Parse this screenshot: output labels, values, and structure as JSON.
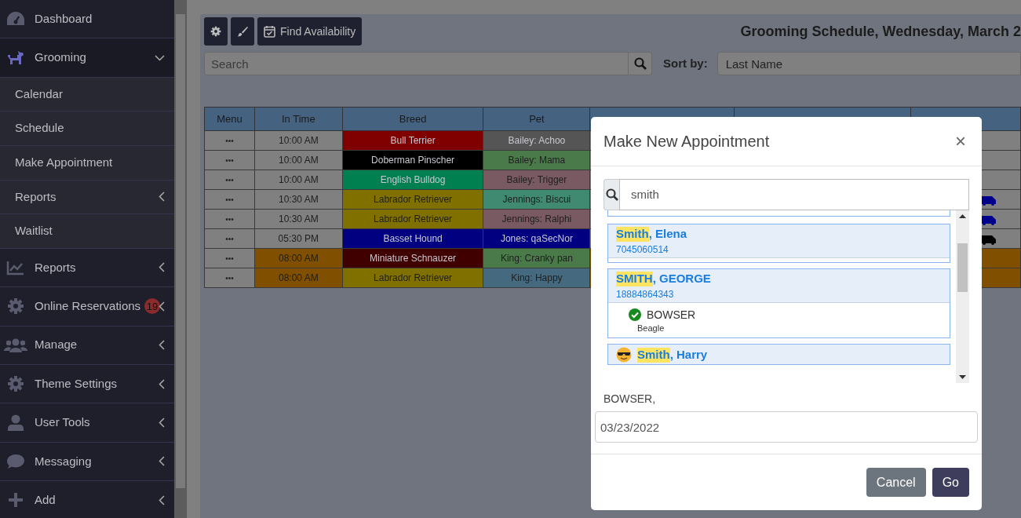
{
  "sidebar": {
    "items": [
      {
        "label": "Dashboard",
        "kind": "gauge",
        "has_submenu": false
      },
      {
        "label": "Grooming",
        "kind": "dog",
        "has_submenu": true,
        "expanded": true,
        "children": [
          {
            "label": "Calendar",
            "has_submenu": false
          },
          {
            "label": "Schedule",
            "has_submenu": false
          },
          {
            "label": "Make Appointment",
            "has_submenu": false
          },
          {
            "label": "Reports",
            "has_submenu": true
          },
          {
            "label": "Waitlist",
            "has_submenu": false
          }
        ]
      },
      {
        "label": "Reports",
        "kind": "chart",
        "has_submenu": true,
        "expanded": false
      },
      {
        "label": "Online Reservations",
        "kind": "gear",
        "has_submenu": true,
        "expanded": false,
        "badge": "19"
      },
      {
        "label": "Manage",
        "kind": "users",
        "has_submenu": true,
        "expanded": false
      },
      {
        "label": "Theme Settings",
        "kind": "gear",
        "has_submenu": true,
        "expanded": false
      },
      {
        "label": "User Tools",
        "kind": "person",
        "has_submenu": true,
        "expanded": false
      },
      {
        "label": "Messaging",
        "kind": "sms",
        "has_submenu": true,
        "expanded": false
      },
      {
        "label": "Add",
        "kind": "plus",
        "has_submenu": true,
        "expanded": false
      }
    ]
  },
  "toolbar": {
    "buttons": [
      {
        "kind": "gear"
      },
      {
        "kind": "brush"
      },
      {
        "kind": "calendar",
        "label": "Find Availability"
      }
    ],
    "title": "Grooming Schedule, Wednesday, March 2"
  },
  "search": {
    "placeholder": "Search",
    "sort_label": "Sort by:",
    "sort_value": "Last Name"
  },
  "table": {
    "columns": [
      "Menu",
      "In Time",
      "Breed",
      "Pet"
    ],
    "rows": [
      {
        "menu": "•••",
        "in_time": {
          "text": "10:00 AM",
          "color": "#808080"
        },
        "breed": {
          "text": "Bull Terrier",
          "color": "#800000"
        },
        "pet": {
          "text": "Bailey: Achoo",
          "color": "#555555"
        },
        "rest": {
          "color": "#808080"
        }
      },
      {
        "menu": "•••",
        "in_time": {
          "text": "10:00 AM",
          "color": "#808080"
        },
        "breed": {
          "text": "Doberman Pinscher",
          "color": "#000000"
        },
        "pet": {
          "text": "Bailey: Mama",
          "color": "#4a7a4a"
        },
        "rest": {
          "color": "#808080"
        }
      },
      {
        "menu": "•••",
        "in_time": {
          "text": "10:00 AM",
          "color": "#808080"
        },
        "breed": {
          "text": "English Bulldog",
          "color": "#008050"
        },
        "pet": {
          "text": "Bailey: Trigger",
          "color": "#7a5a62"
        },
        "rest": {
          "color": "#808080"
        }
      },
      {
        "menu": "•••",
        "in_time": {
          "text": "10:30 AM",
          "color": "#808080"
        },
        "breed": {
          "text": "Labrador Retriever",
          "color": "#807000"
        },
        "pet": {
          "text": "Jennings: Biscui",
          "color": "#3f8a70"
        },
        "rest": {
          "color": "#808080"
        },
        "van": {
          "color": "#00008b"
        }
      },
      {
        "menu": "•••",
        "in_time": {
          "text": "10:30 AM",
          "color": "#808080"
        },
        "breed": {
          "text": "Labrador Retriever",
          "color": "#807000"
        },
        "pet": {
          "text": "Jennings: Ralphi",
          "color": "#7a5a62"
        },
        "rest": {
          "color": "#808080"
        },
        "van": {
          "color": "#00008b"
        }
      },
      {
        "menu": "•••",
        "in_time": {
          "text": "05:30 PM",
          "color": "#808080"
        },
        "breed": {
          "text": "Basset Hound",
          "color": "#000080"
        },
        "pet": {
          "text": "Jones: qaSecNor",
          "color": "#000080"
        },
        "rest": {
          "color": "#808080"
        },
        "van": {
          "color": "#000000"
        }
      },
      {
        "menu": "•••",
        "in_time": {
          "text": "08:00 AM",
          "color": "#805000"
        },
        "breed": {
          "text": "Miniature Schnauzer",
          "color": "#400000"
        },
        "pet": {
          "text": "King: Cranky pan",
          "color": "#4a7a4a"
        },
        "rest": {
          "color": "#805000"
        }
      },
      {
        "menu": "•••",
        "in_time": {
          "text": "08:00 AM",
          "color": "#805000"
        },
        "breed": {
          "text": "Labrador Retriever",
          "color": "#807000"
        },
        "pet": {
          "text": "King: Happy",
          "color": "#456a80"
        },
        "rest": {
          "color": "#805000"
        }
      }
    ]
  },
  "modal": {
    "title": "Make New Appointment",
    "close": "×",
    "search_value": "smith",
    "customers": [
      {
        "name_match": "Smith",
        "name_rest": ", Elena",
        "phone": "7045060514",
        "flagged": false
      },
      {
        "name_match": "SMITH",
        "name_rest": ", GEORGE",
        "phone": "18884864343",
        "flagged": false,
        "pets": [
          {
            "name": "BOWSER",
            "breed": "Beagle",
            "selected": true
          }
        ]
      },
      {
        "name_match": "Smith",
        "name_rest": ", Harry",
        "flagged": true
      }
    ],
    "selection_label": "BOWSER,",
    "date": "03/23/2022",
    "buttons": [
      {
        "label": "Cancel",
        "kind": "secondary"
      },
      {
        "label": "Go",
        "kind": "primary"
      }
    ]
  }
}
